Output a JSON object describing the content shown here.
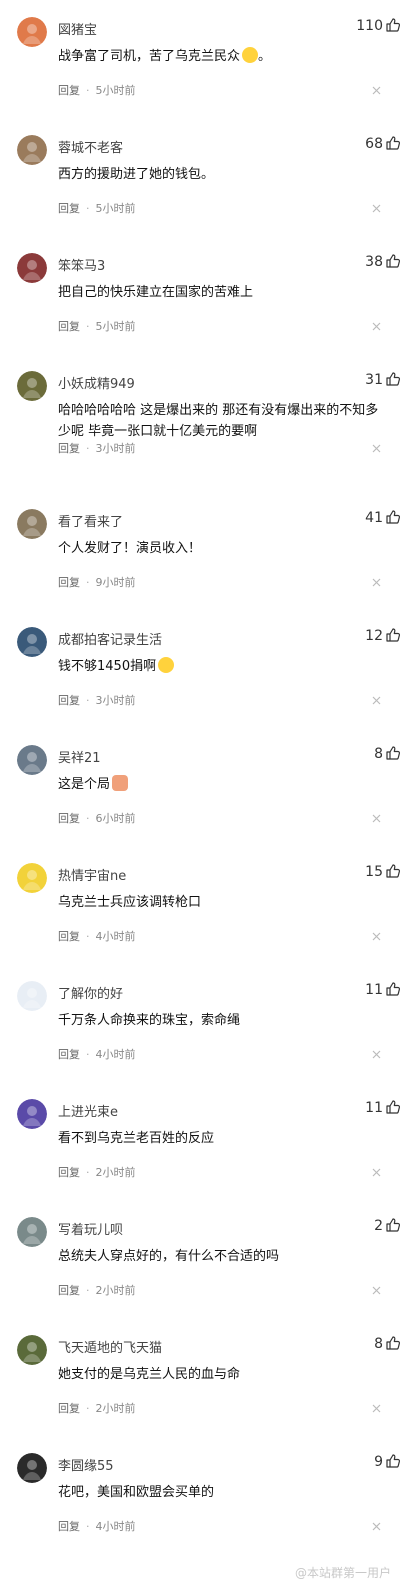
{
  "ui": {
    "reply_label": "回复",
    "separator": "·"
  },
  "comments": [
    {
      "username": "図猪宝",
      "likes": "110",
      "text": "战争富了司机，苦了乌克兰民众",
      "suffix": "。",
      "emoji": "face",
      "time": "5小时前",
      "avatar_color": "#e07a4a"
    },
    {
      "username": "蓉城不老客",
      "likes": "68",
      "text": "西方的援助进了她的钱包。",
      "suffix": "",
      "emoji": "",
      "time": "5小时前",
      "avatar_color": "#9a7b5c"
    },
    {
      "username": "笨笨马3",
      "likes": "38",
      "text": "把自己的快乐建立在国家的苦难上",
      "suffix": "",
      "emoji": "",
      "time": "5小时前",
      "avatar_color": "#8b3a3a"
    },
    {
      "username": "小妖成精949",
      "likes": "31",
      "text": "哈哈哈哈哈哈 这是爆出来的 那还有没有爆出来的不知多少呢 毕竟一张口就十亿美元的要啊",
      "suffix": "",
      "emoji": "",
      "time": "3小时前",
      "avatar_color": "#6b6b3a"
    },
    {
      "username": "看了看来了",
      "likes": "41",
      "text": "个人发财了！演员收入！",
      "suffix": "",
      "emoji": "",
      "time": "9小时前",
      "avatar_color": "#8a7a60"
    },
    {
      "username": "成都拍客记录生活",
      "likes": "12",
      "text": "钱不够1450捐啊",
      "suffix": "",
      "emoji": "face",
      "time": "3小时前",
      "avatar_color": "#3a5a7a"
    },
    {
      "username": "吴祥21",
      "likes": "8",
      "text": "这是个局",
      "suffix": "",
      "emoji": "hand",
      "time": "6小时前",
      "avatar_color": "#6a7a8a"
    },
    {
      "username": "热情宇宙ne",
      "likes": "15",
      "text": "乌克兰士兵应该调转枪口",
      "suffix": "",
      "emoji": "",
      "time": "4小时前",
      "avatar_color": "#f2d23a"
    },
    {
      "username": "了解你的好",
      "likes": "11",
      "text": "千万条人命换来的珠宝，索命绳",
      "suffix": "",
      "emoji": "",
      "time": "4小时前",
      "avatar_color": "#e8eef5"
    },
    {
      "username": "上进光束e",
      "likes": "11",
      "text": "看不到乌克兰老百姓的反应",
      "suffix": "",
      "emoji": "",
      "time": "2小时前",
      "avatar_color": "#5a4aa8"
    },
    {
      "username": "写着玩儿呗",
      "likes": "2",
      "text": "总统夫人穿点好的，有什么不合适的吗",
      "suffix": "",
      "emoji": "",
      "time": "2小时前",
      "avatar_color": "#7a8a8a"
    },
    {
      "username": "飞天遁地的飞天猫",
      "likes": "8",
      "text": "她支付的是乌克兰人民的血与命",
      "suffix": "",
      "emoji": "",
      "time": "2小时前",
      "avatar_color": "#5a6a3a"
    },
    {
      "username": "李圆缘55",
      "likes": "9",
      "text": "花吧，美国和欧盟会买单的",
      "suffix": "",
      "emoji": "",
      "time": "4小时前",
      "avatar_color": "#2a2a2a"
    }
  ],
  "watermark": "@本站群第一用户"
}
